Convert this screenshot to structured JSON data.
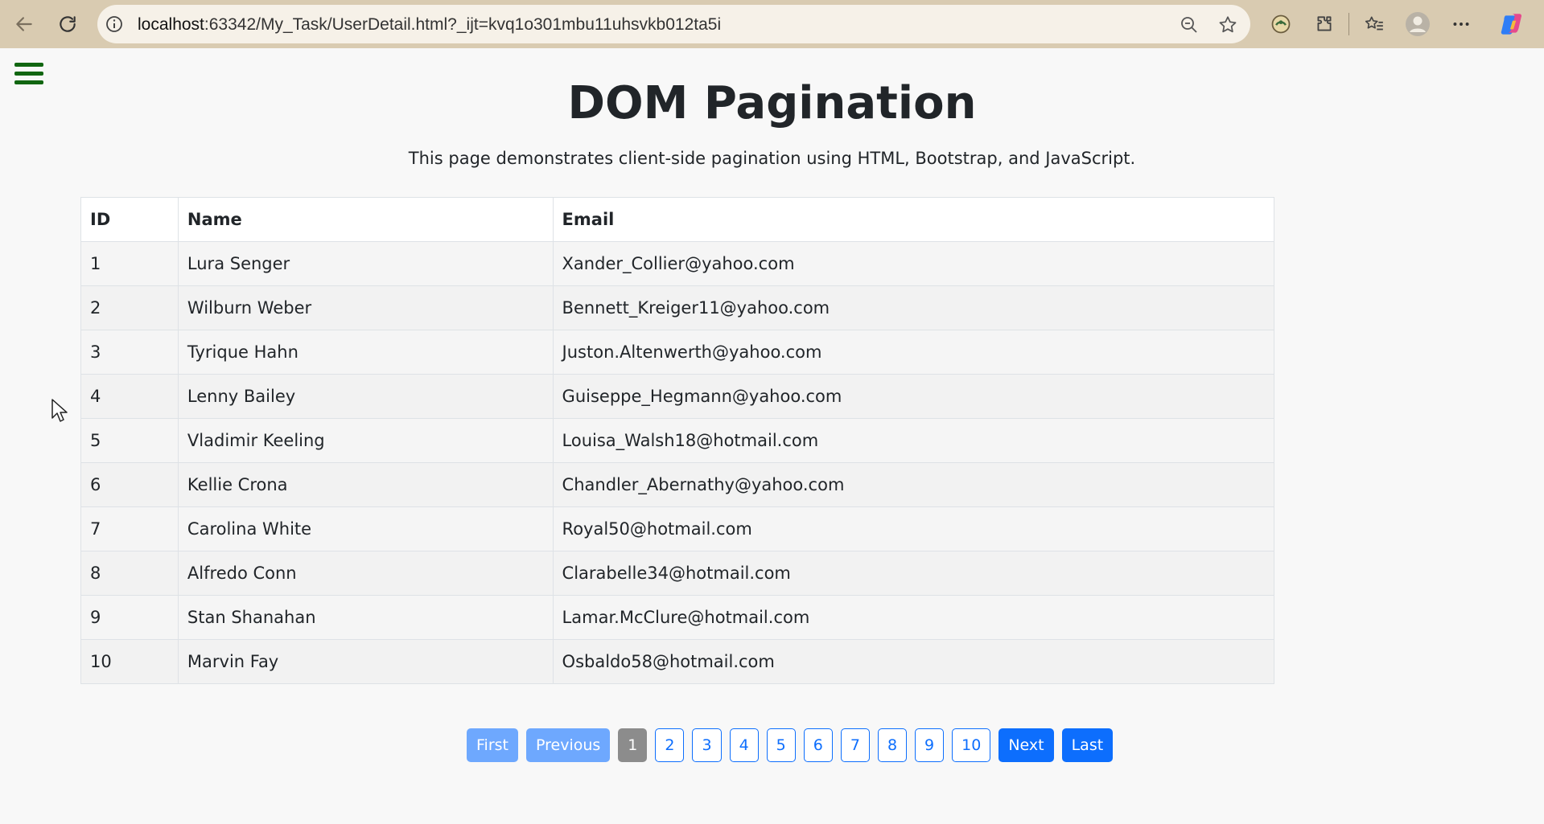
{
  "browser": {
    "url_host": "localhost",
    "url_rest": ":63342/My_Task/UserDetail.html?_ijt=kvq1o301mbu11uhsvkb012ta5i"
  },
  "page": {
    "title": "DOM Pagination",
    "subtitle": "This page demonstrates client-side pagination using HTML, Bootstrap, and JavaScript."
  },
  "table": {
    "headers": [
      "ID",
      "Name",
      "Email"
    ],
    "rows": [
      {
        "id": "1",
        "name": "Lura Senger",
        "email": "Xander_Collier@yahoo.com"
      },
      {
        "id": "2",
        "name": "Wilburn Weber",
        "email": "Bennett_Kreiger11@yahoo.com"
      },
      {
        "id": "3",
        "name": "Tyrique Hahn",
        "email": "Juston.Altenwerth@yahoo.com"
      },
      {
        "id": "4",
        "name": "Lenny Bailey",
        "email": "Guiseppe_Hegmann@yahoo.com"
      },
      {
        "id": "5",
        "name": "Vladimir Keeling",
        "email": "Louisa_Walsh18@hotmail.com"
      },
      {
        "id": "6",
        "name": "Kellie Crona",
        "email": "Chandler_Abernathy@yahoo.com"
      },
      {
        "id": "7",
        "name": "Carolina White",
        "email": "Royal50@hotmail.com"
      },
      {
        "id": "8",
        "name": "Alfredo Conn",
        "email": "Clarabelle34@hotmail.com"
      },
      {
        "id": "9",
        "name": "Stan Shanahan",
        "email": "Lamar.McClure@hotmail.com"
      },
      {
        "id": "10",
        "name": "Marvin Fay",
        "email": "Osbaldo58@hotmail.com"
      }
    ]
  },
  "pagination": {
    "first": "First",
    "previous": "Previous",
    "pages": [
      "1",
      "2",
      "3",
      "4",
      "5",
      "6",
      "7",
      "8",
      "9",
      "10"
    ],
    "current": "1",
    "next": "Next",
    "last": "Last"
  },
  "colors": {
    "hamburger": "#116611",
    "primary": "#0d6efd",
    "primary_soft": "#6ea8fe",
    "active_page": "#8c8c8c",
    "browser_bar": "#d9cbb1"
  }
}
